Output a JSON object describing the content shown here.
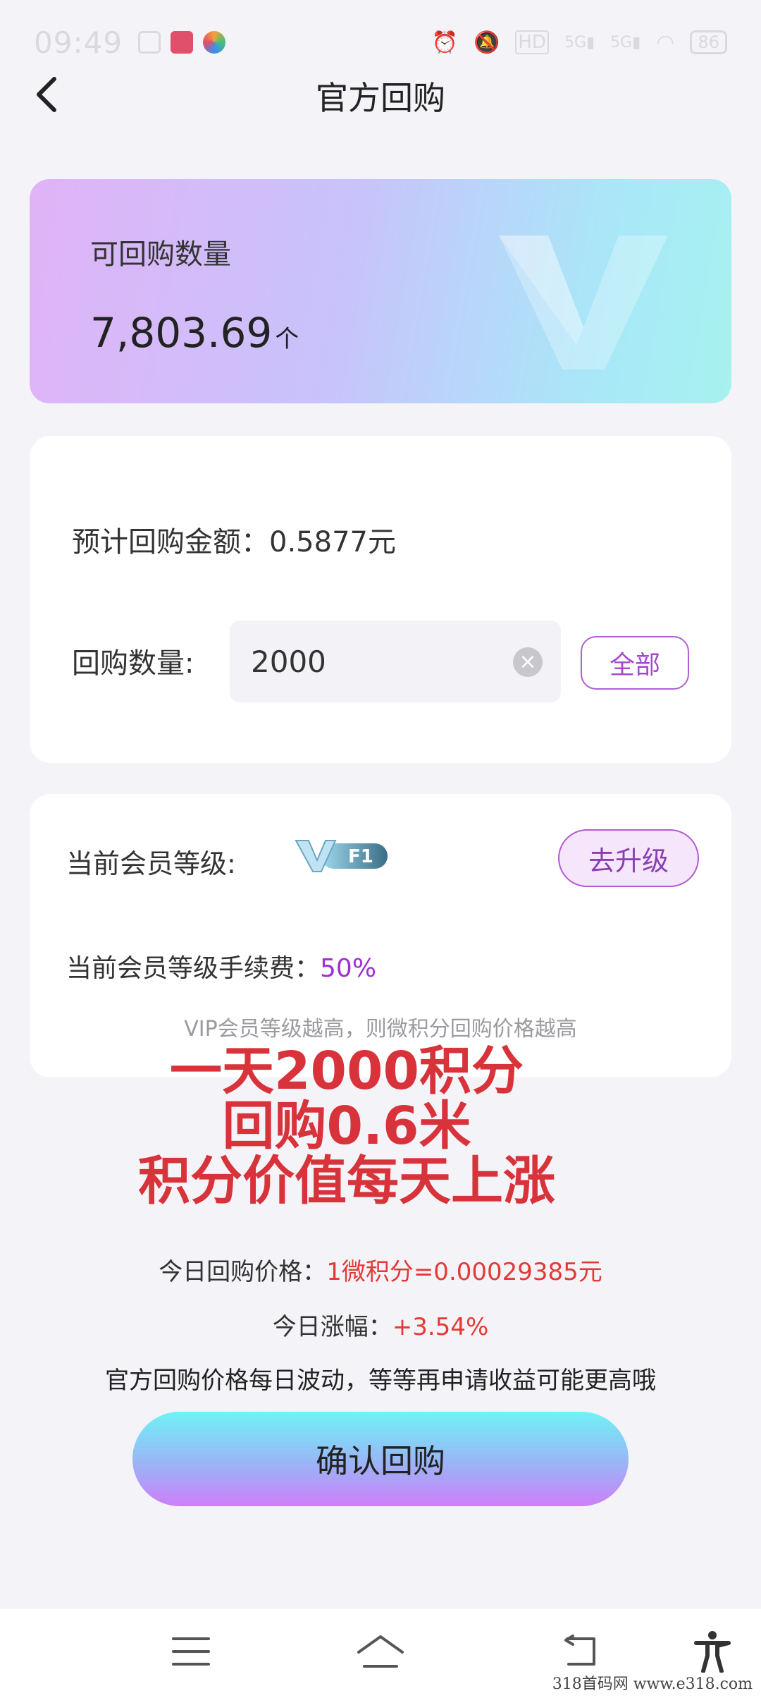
{
  "status_bar": {
    "time": "09:49",
    "battery": "86"
  },
  "header": {
    "title": "官方回购"
  },
  "banner": {
    "label": "可回购数量",
    "value": "7,803.69",
    "unit": "个"
  },
  "estimate": {
    "label": "预计回购金额：",
    "value": "0.5877元"
  },
  "quantity": {
    "label": "回购数量:",
    "value": "2000",
    "all_label": "全部"
  },
  "membership": {
    "level_label": "当前会员等级:",
    "badge_text": "F1",
    "upgrade_label": "去升级",
    "fee_label": "当前会员等级手续费：",
    "fee_value": "50%",
    "hint": "VIP会员等级越高，则微积分回购价格越高"
  },
  "overlay_text": [
    "一天2000积分",
    "回购0.6米",
    "积分价值每天上涨"
  ],
  "today_price": {
    "label": "今日回购价格：",
    "value": "1微积分=0.00029385元"
  },
  "today_change": {
    "label": "今日涨幅：",
    "value": "+3.54%"
  },
  "notice": "官方回购价格每日波动，等等再申请收益可能更高哦",
  "confirm_label": "确认回购",
  "watermark": "318首码网  www.e318.com",
  "colors": {
    "accent_purple": "#a648cc",
    "price_red": "#e53935",
    "overlay_red": "#d8323a"
  }
}
